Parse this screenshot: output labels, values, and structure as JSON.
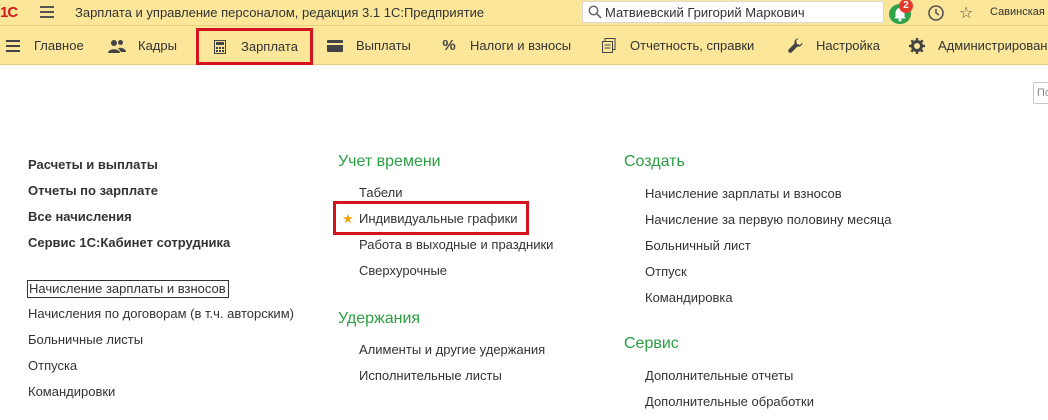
{
  "titlebar": {
    "logo": "1С",
    "app_title": "Зарплата и управление персоналом, редакция 3.1 1С:Предприятие",
    "user": "Матвиевский Григорий Маркович",
    "notifications_count": "2",
    "org": "Савинская"
  },
  "menu": {
    "items": [
      {
        "label": "Главное",
        "icon": "hamburger-icon"
      },
      {
        "label": "Кадры",
        "icon": "people-icon"
      },
      {
        "label": "Зарплата",
        "icon": "calculator-icon"
      },
      {
        "label": "Выплаты",
        "icon": "card-icon"
      },
      {
        "label": "Налоги и взносы",
        "icon": "percent-icon"
      },
      {
        "label": "Отчетность, справки",
        "icon": "documents-icon"
      },
      {
        "label": "Настройка",
        "icon": "wrench-icon"
      },
      {
        "label": "Администрирование",
        "icon": "gear-icon"
      }
    ],
    "active": "Зарплата"
  },
  "search_stub": "По",
  "left": {
    "bold": [
      "Расчеты и выплаты",
      "Отчеты по зарплате",
      "Все начисления",
      "Сервис 1С:Кабинет сотрудника"
    ],
    "links": [
      "Начисление зарплаты и взносов",
      "Начисления по договорам (в т.ч. авторским)",
      "Больничные листы",
      "Отпуска",
      "Командировки"
    ]
  },
  "middle": {
    "time_heading": "Учет времени",
    "time_links": [
      "Табели",
      "Индивидуальные графики",
      "Работа в выходные и праздники",
      "Сверхурочные"
    ],
    "deduct_heading": "Удержания",
    "deduct_links": [
      "Алименты и другие удержания",
      "Исполнительные листы"
    ]
  },
  "right": {
    "create_heading": "Создать",
    "create_links": [
      "Начисление зарплаты и взносов",
      "Начисление за первую половину месяца",
      "Больничный лист",
      "Отпуск",
      "Командировка"
    ],
    "service_heading": "Сервис",
    "service_links": [
      "Дополнительные отчеты",
      "Дополнительные обработки"
    ]
  },
  "colors": {
    "accent_green": "#2a9f42",
    "highlight_red": "#d3141f",
    "panel_yellow": "#fbe69a"
  }
}
